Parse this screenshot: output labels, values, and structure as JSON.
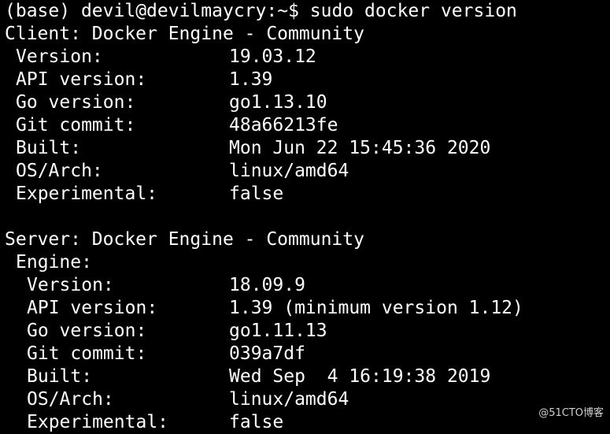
{
  "prompt": {
    "env": "(base)",
    "user_host": "devil@devilmaycry",
    "path": "~",
    "symbol": "$",
    "command": "sudo docker version"
  },
  "client": {
    "header": "Client: Docker Engine - Community",
    "fields": [
      {
        "key": "Version:",
        "value": "19.03.12"
      },
      {
        "key": "API version:",
        "value": "1.39"
      },
      {
        "key": "Go version:",
        "value": "go1.13.10"
      },
      {
        "key": "Git commit:",
        "value": "48a66213fe"
      },
      {
        "key": "Built:",
        "value": "Mon Jun 22 15:45:36 2020"
      },
      {
        "key": "OS/Arch:",
        "value": "linux/amd64"
      },
      {
        "key": "Experimental:",
        "value": "false"
      }
    ]
  },
  "server": {
    "header": "Server: Docker Engine - Community",
    "subheader": "Engine:",
    "fields": [
      {
        "key": "Version:",
        "value": "18.09.9"
      },
      {
        "key": "API version:",
        "value": "1.39 (minimum version 1.12)"
      },
      {
        "key": "Go version:",
        "value": "go1.11.13"
      },
      {
        "key": "Git commit:",
        "value": "039a7df"
      },
      {
        "key": "Built:",
        "value": "Wed Sep  4 16:19:38 2019"
      },
      {
        "key": "OS/Arch:",
        "value": "linux/amd64"
      },
      {
        "key": "Experimental:",
        "value": "false"
      }
    ]
  },
  "watermark": "@51CTO博客"
}
